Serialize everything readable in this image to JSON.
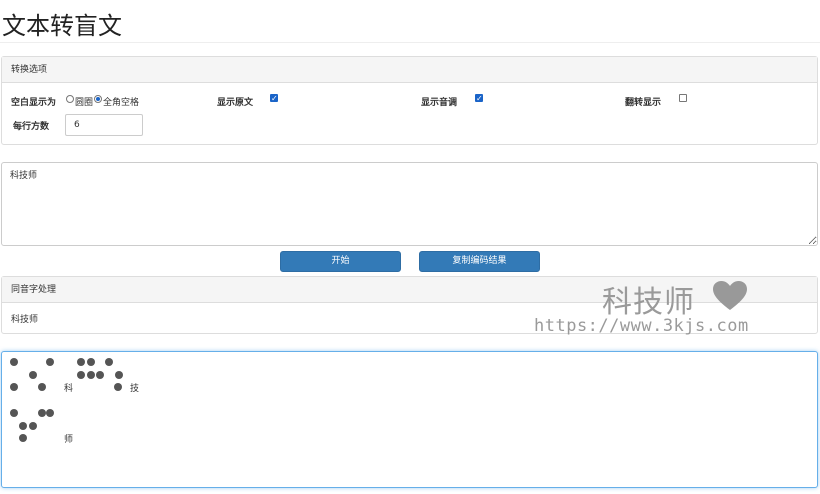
{
  "page": {
    "title": "文本转盲文"
  },
  "options": {
    "heading": "转换选项",
    "blank_display_label": "空白显示为",
    "blank_option_circle": "圆圈",
    "blank_option_fullwidth": "全角空格",
    "blank_selected": "全角空格",
    "show_original_label": "显示原文",
    "show_original": true,
    "show_tone_label": "显示音调",
    "show_tone": true,
    "flip_label": "翻转显示",
    "flip": false,
    "cells_per_line_label": "每行方数",
    "cells_per_line": "6"
  },
  "input": {
    "text": "科技师"
  },
  "buttons": {
    "start": "开始",
    "copy": "复制编码结果"
  },
  "homophone": {
    "heading": "同音字处理",
    "text": "科技师"
  },
  "output": {
    "chars": [
      {
        "char": "科"
      },
      {
        "char": "技"
      },
      {
        "char": "师"
      }
    ]
  },
  "watermark": {
    "name": "科技师",
    "url": "https://www.3kjs.com",
    "heart_color": "#999999"
  },
  "colors": {
    "primary_button": "#337ab7",
    "focus_border": "#66afe9",
    "checkbox_checked": "#1a64c8"
  }
}
